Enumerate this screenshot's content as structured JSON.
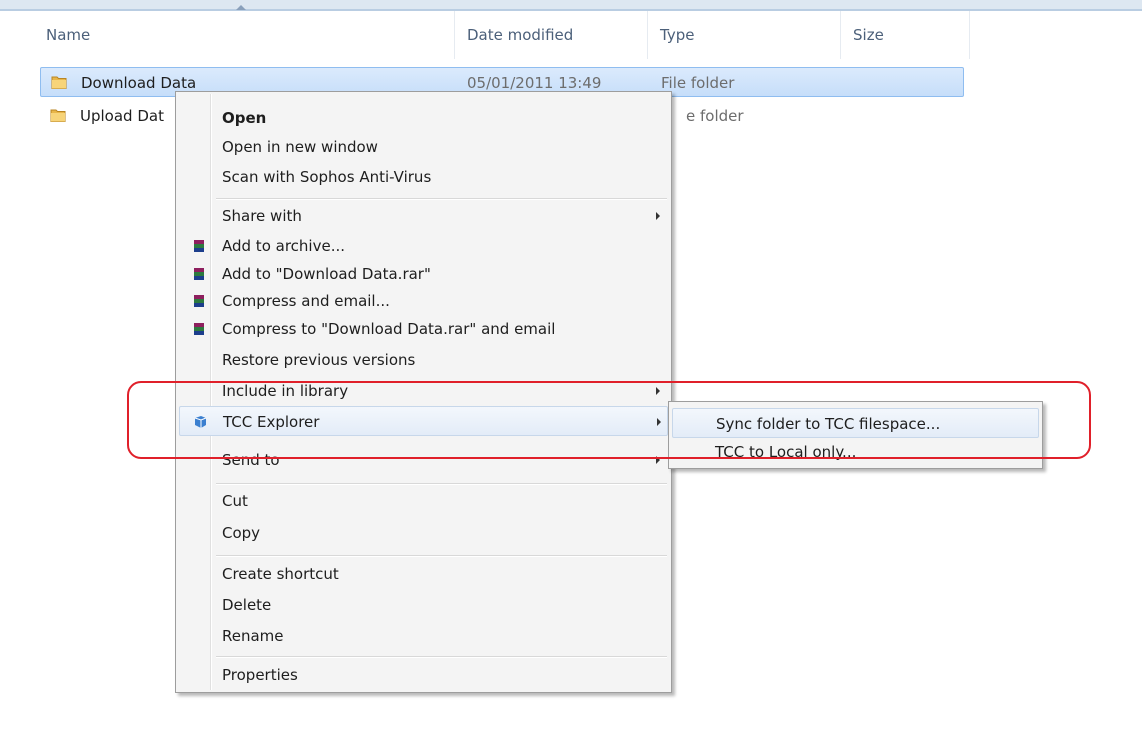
{
  "columns": [
    "Name",
    "Date modified",
    "Type",
    "Size"
  ],
  "files": [
    {
      "name": "Download Data",
      "date": "05/01/2011 13:49",
      "type": "File folder"
    },
    {
      "name": "Upload Dat",
      "date": "",
      "type": "e folder"
    }
  ],
  "context_menu": {
    "open": "Open",
    "open_new_window": "Open in new window",
    "scan": "Scan with Sophos Anti-Virus",
    "share_with": "Share with",
    "add_archive": "Add to archive...",
    "add_rar": "Add to \"Download Data.rar\"",
    "compress_email": "Compress and email...",
    "compress_rar_email": "Compress to \"Download Data.rar\" and email",
    "restore": "Restore previous versions",
    "include_library": "Include in library",
    "tcc_explorer": "TCC Explorer",
    "send_to": "Send to",
    "cut": "Cut",
    "copy": "Copy",
    "create_shortcut": "Create shortcut",
    "delete": "Delete",
    "rename": "Rename",
    "properties": "Properties"
  },
  "submenu": {
    "sync": "Sync folder to TCC filespace...",
    "local_only": "TCC to Local only..."
  },
  "colors": {
    "selection": "#cce4fb",
    "callout": "#e0202a",
    "header_text": "#4c607a"
  }
}
